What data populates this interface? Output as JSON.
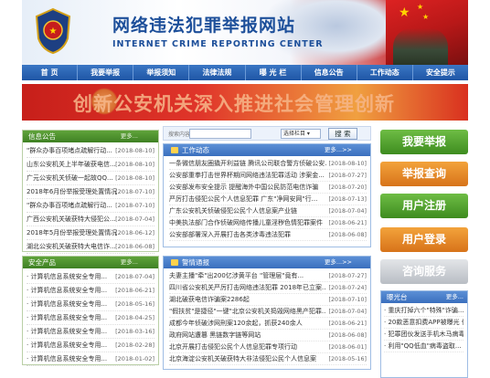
{
  "header": {
    "title": "网络违法犯罪举报网站",
    "subtitle": "INTERNET CRIME REPORTING CENTER"
  },
  "nav": [
    "首 页",
    "我要举报",
    "举报须知",
    "法律法规",
    "曝 光 栏",
    "信息公告",
    "工作动态",
    "安全提示"
  ],
  "banner": {
    "text": "创新公安机关深入推进社会管理创新"
  },
  "notices": {
    "title": "信息公告",
    "more": "更多...",
    "items": [
      {
        "text": "\"群众办事百项堵点疏解行动...",
        "date": "[2018-08-10]"
      },
      {
        "text": "山东公安机关上半年破获电信...",
        "date": "[2018-08-10]"
      },
      {
        "text": "广元公安机关侦破一起故QQ...",
        "date": "[2018-08-10]"
      },
      {
        "text": "2018年6月份举报受理处置情况",
        "date": "[2018-07-10]"
      },
      {
        "text": "\"群众办事百项堵点疏解行动...",
        "date": "[2018-07-10]"
      },
      {
        "text": "广西公安机关破获特大侵犯公...",
        "date": "[2018-07-04]"
      },
      {
        "text": "2018年5月份举报受理处置情况",
        "date": "[2018-06-12]"
      },
      {
        "text": "湖北公安机关破获特大电信诈...",
        "date": "[2018-06-08]"
      }
    ]
  },
  "safety": {
    "title": "安全产品",
    "more": "更多...",
    "items": [
      {
        "text": "· 计算机信息系统安全专用...",
        "date": "[2018-07-04]"
      },
      {
        "text": "· 计算机信息系统安全专用...",
        "date": "[2018-06-21]"
      },
      {
        "text": "· 计算机信息系统安全专用...",
        "date": "[2018-05-16]"
      },
      {
        "text": "· 计算机信息系统安全专用...",
        "date": "[2018-04-25]"
      },
      {
        "text": "· 计算机信息系统安全专用...",
        "date": "[2018-03-16]"
      },
      {
        "text": "· 计算机信息系统安全专用...",
        "date": "[2018-02-28]"
      },
      {
        "text": "· 计算机信息系统安全专用...",
        "date": "[2018-01-02]"
      }
    ]
  },
  "search": {
    "label": "搜索内容",
    "select": "选择栏目",
    "button": "搜 索"
  },
  "work": {
    "title": "工作动态",
    "more": "更多...>>",
    "items": [
      {
        "text": "一条微信朋友圈撬开利益链 腾讯公司联合警方侦破公安...",
        "date": "[2018-08-10]"
      },
      {
        "text": "公安部重拳打击世界杯期间网络违法犯罪活动 涉案金...",
        "date": "[2018-07-27]"
      },
      {
        "text": "公安部发布安全提示 提醒海外中国公民防范电信诈骗",
        "date": "[2018-07-20]"
      },
      {
        "text": "严厉打击侵犯公民个人信息犯罪 广东\"净网安网\"行...",
        "date": "[2018-07-13]"
      },
      {
        "text": "广东公安机关侦破侵犯公民个人信息案产业链",
        "date": "[2018-07-04]"
      },
      {
        "text": "中美执法部门合作侦破网络传播儿童淫秽色情犯罪案件",
        "date": "[2018-06-21]"
      },
      {
        "text": "公安部部署深入开展打击各类涉毒违法犯罪",
        "date": "[2018-06-08]"
      }
    ]
  },
  "alerts": {
    "title": "警情通报",
    "more": "更多...>>",
    "items": [
      {
        "text": "夫妻主播\"牵\"出200亿涉黄平台 \"管理层\"竟有...",
        "date": "[2018-07-27]"
      },
      {
        "text": "四川省公安机关严厉打击网络违法犯罪 2018年已立案...",
        "date": "[2018-07-24]"
      },
      {
        "text": "湖北破获电信诈骗案2286起",
        "date": "[2018-07-10]"
      },
      {
        "text": "\"假扶贫\"是捷径\"一键\"北京公安机关捣毁网络黑产犯罪...",
        "date": "[2018-07-04]"
      },
      {
        "text": "成都今年侦破涉网刑案120余起，抓获240余人",
        "date": "[2018-06-21]"
      },
      {
        "text": "政府网站遭篡 黑链数字链等网站",
        "date": "[2018-06-08]"
      },
      {
        "text": "北京开展打击侵犯公民个人信息犯罪专项行动",
        "date": "[2018-06-01]"
      },
      {
        "text": "北京海淀公安机关破获特大非法侵犯公民个人信息案",
        "date": "[2018-05-16]"
      }
    ]
  },
  "buttons": [
    "我要举报",
    "举报查询",
    "用户注册",
    "用户登录",
    "咨询服务"
  ],
  "exposure": {
    "title": "曝光台",
    "more": "更多...",
    "items": [
      {
        "text": "· 重庆打掉六个\"特殊\"诈骗..."
      },
      {
        "text": "· 20款恶意扣费APP被曝光 传..."
      },
      {
        "text": "· 犯罪团伙发送手机木马病毒..."
      },
      {
        "text": "· 利用\"QQ低血\"病毒盗取..."
      }
    ]
  },
  "colors": {
    "nav": "#1f56a5",
    "green": "#3e8c1f",
    "orange": "#d7731a",
    "blue": "#3a6fbd"
  }
}
